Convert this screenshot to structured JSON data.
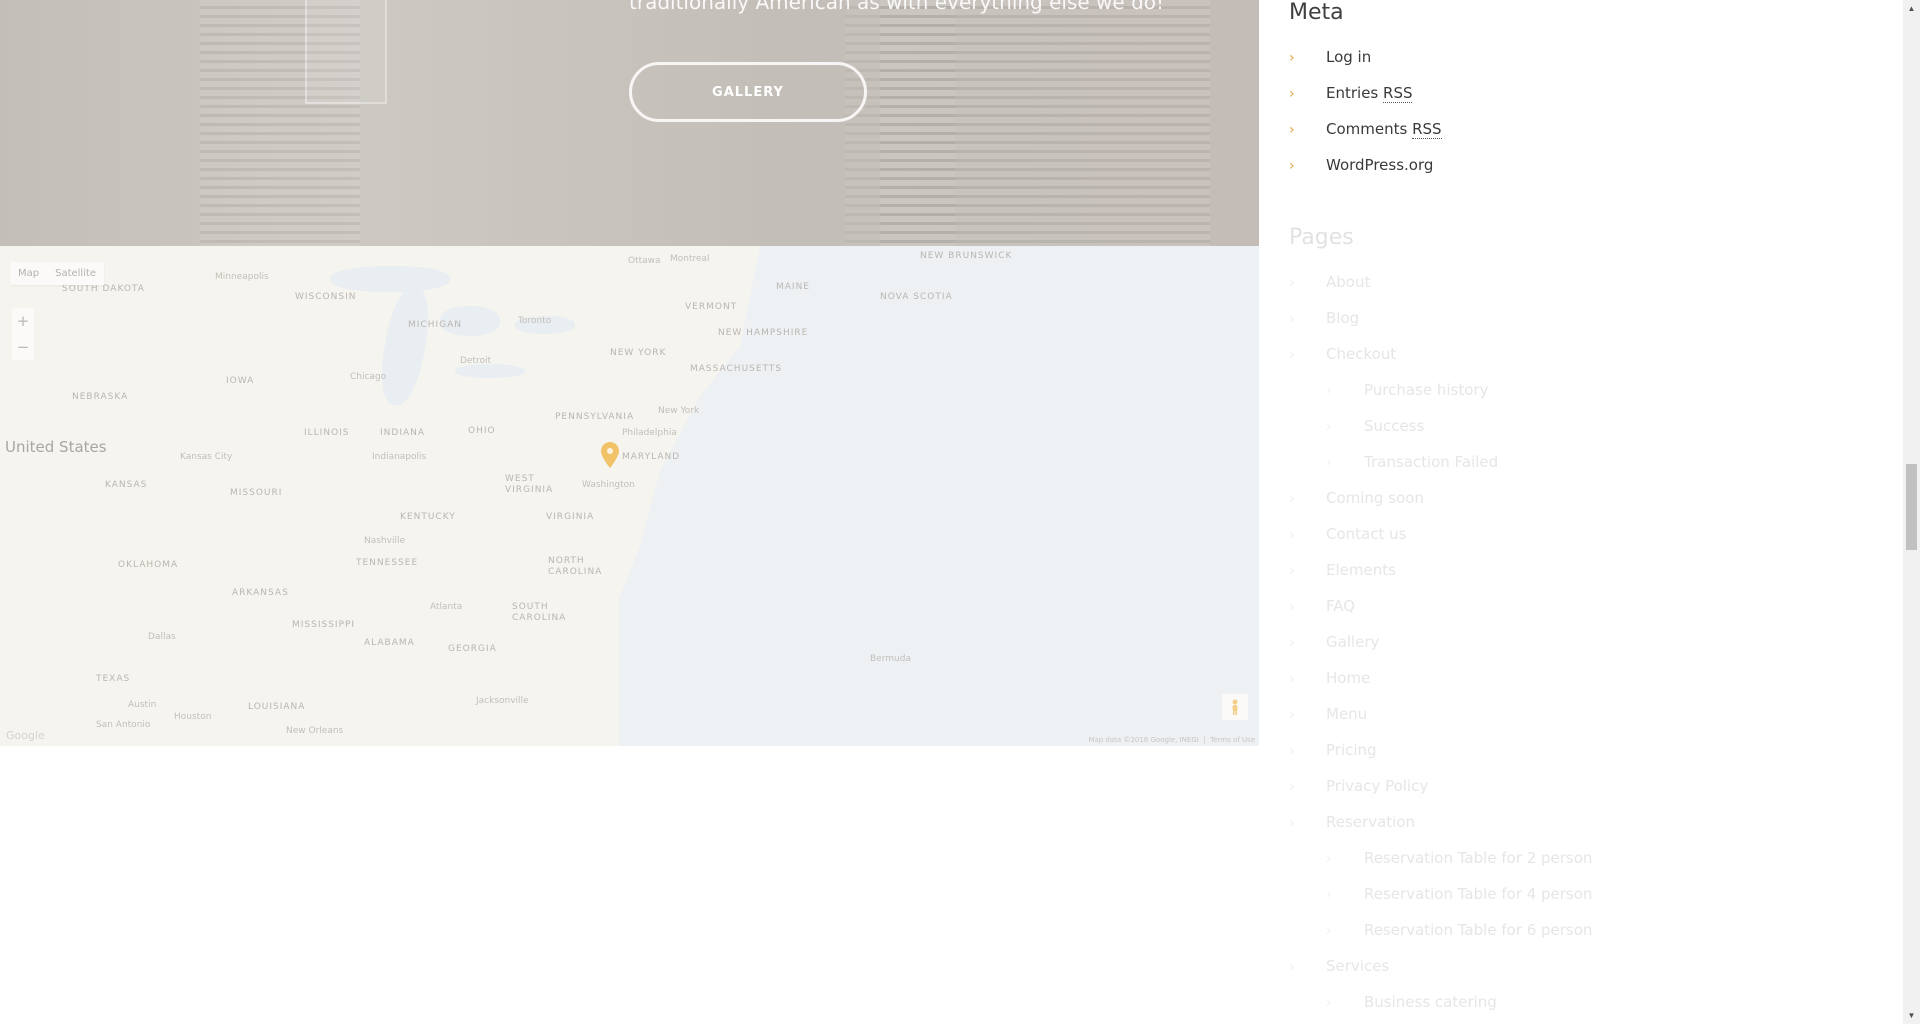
{
  "hero": {
    "tagline": "traditionally American as with everything else we do!",
    "gallery_button": "GALLERY"
  },
  "map": {
    "type_map": "Map",
    "type_satellite": "Satellite",
    "zoom_in": "+",
    "zoom_out": "−",
    "country_label": "United States",
    "footer_data": "Map data ©2018 Google, INEGI",
    "footer_terms": "Terms of Use",
    "logo": "Google",
    "labels": {
      "south_dakota": "SOUTH DAKOTA",
      "minneapolis": "Minneapolis",
      "wisconsin": "WISCONSIN",
      "michigan": "MICHIGAN",
      "toronto": "Toronto",
      "ottawa": "Ottawa",
      "montreal": "Montreal",
      "maine": "MAINE",
      "vermont": "VERMONT",
      "new_hampshire": "NEW HAMPSHIRE",
      "massachusetts": "MASSACHUSETTS",
      "nova_scotia": "NOVA SCOTIA",
      "new_brunswick": "NEW BRUNSWICK",
      "new_york_state": "NEW YORK",
      "nebraska": "NEBRASKA",
      "iowa": "IOWA",
      "chicago": "Chicago",
      "detroit": "Detroit",
      "ohio": "OHIO",
      "illinois": "ILLINOIS",
      "indiana": "INDIANA",
      "pennsylvania": "PENNSYLVANIA",
      "new_york_city": "New York",
      "philadelphia": "Philadelphia",
      "kansas_city": "Kansas City",
      "indianapolis": "Indianapolis",
      "maryland": "MARYLAND",
      "kansas": "KANSAS",
      "missouri": "MISSOURI",
      "west_virginia": "WEST VIRGINIA",
      "washington": "Washington",
      "kentucky": "KENTUCKY",
      "virginia": "VIRGINIA",
      "nashville": "Nashville",
      "oklahoma": "OKLAHOMA",
      "tennessee": "TENNESSEE",
      "north_carolina": "NORTH CAROLINA",
      "arkansas": "ARKANSAS",
      "atlanta": "Atlanta",
      "south_carolina": "SOUTH CAROLINA",
      "mississippi": "MISSISSIPPI",
      "alabama": "ALABAMA",
      "georgia": "GEORGIA",
      "dallas": "Dallas",
      "texas": "TEXAS",
      "austin": "Austin",
      "houston": "Houston",
      "san_antonio": "San Antonio",
      "louisiana": "LOUISIANA",
      "new_orleans": "New Orleans",
      "jacksonville": "Jacksonville",
      "bermuda": "Bermuda"
    }
  },
  "meta": {
    "title": "Meta",
    "items": [
      {
        "label": "Log in"
      },
      {
        "prefix": "Entries ",
        "abbr": "RSS"
      },
      {
        "prefix": "Comments ",
        "abbr": "RSS"
      },
      {
        "label": "WordPress.org"
      }
    ]
  },
  "pages": {
    "title": "Pages",
    "items": [
      {
        "label": "About"
      },
      {
        "label": "Blog"
      },
      {
        "label": "Checkout"
      },
      {
        "label": "Purchase history"
      },
      {
        "label": "Success"
      },
      {
        "label": "Transaction Failed"
      },
      {
        "label": "Coming soon"
      },
      {
        "label": "Contact us"
      },
      {
        "label": "Elements"
      },
      {
        "label": "FAQ"
      },
      {
        "label": "Gallery"
      },
      {
        "label": "Home"
      },
      {
        "label": "Menu"
      },
      {
        "label": "Pricing"
      },
      {
        "label": "Privacy Policy"
      },
      {
        "label": "Reservation"
      },
      {
        "label": "Reservation Table for 2 person"
      },
      {
        "label": "Reservation Table for 4 person"
      },
      {
        "label": "Reservation Table for 6 person"
      },
      {
        "label": "Services"
      },
      {
        "label": "Business catering"
      }
    ]
  },
  "colors": {
    "accent": "#e2a33b",
    "pin": "#f0b23c"
  }
}
